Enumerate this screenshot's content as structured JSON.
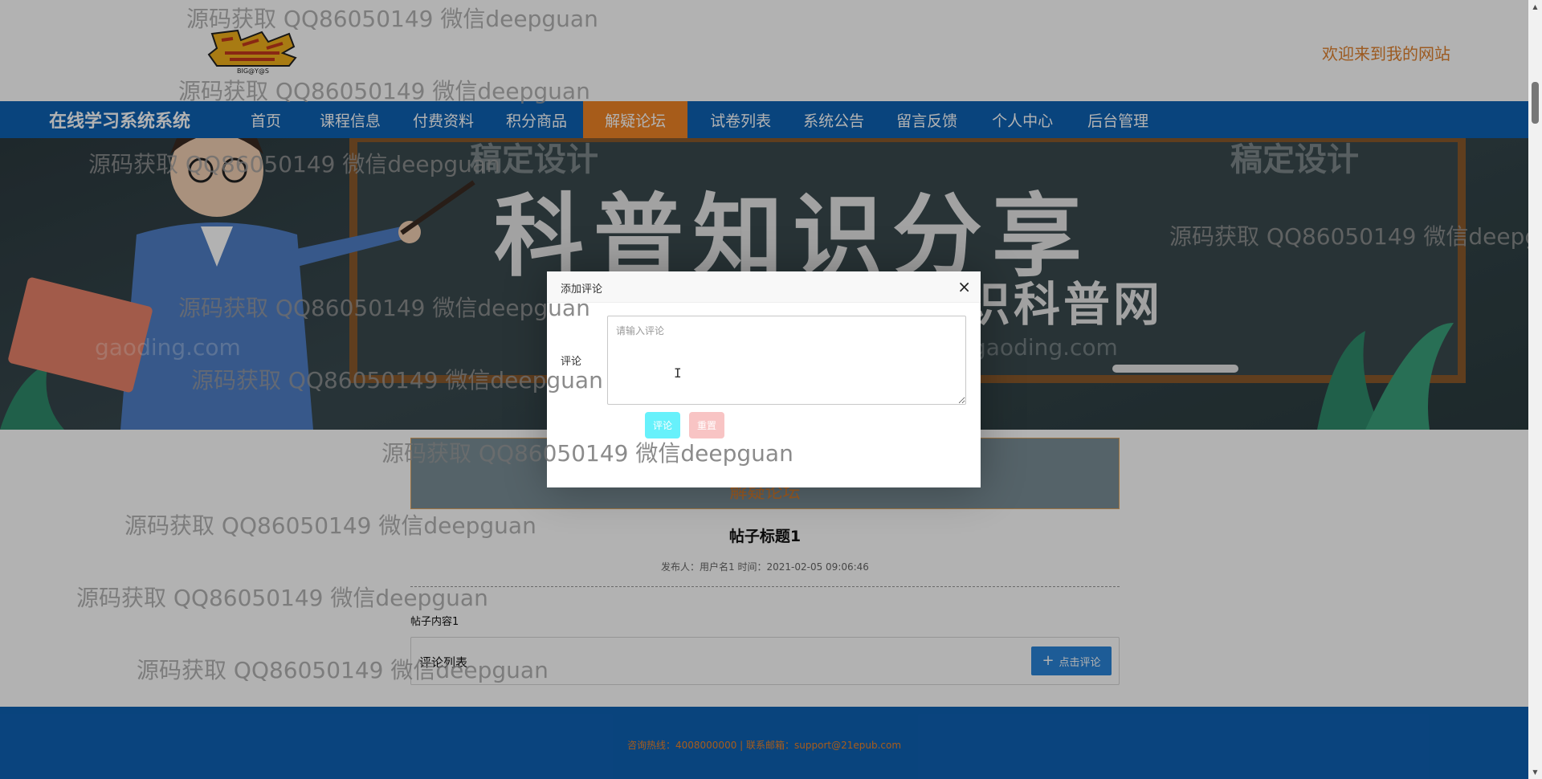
{
  "header": {
    "logo_text": "BIG@Y@S",
    "welcome": "欢迎来到我的网站"
  },
  "nav": {
    "brand": "在线学习系统系统",
    "items": [
      {
        "label": "首页"
      },
      {
        "label": "课程信息"
      },
      {
        "label": "付费资料"
      },
      {
        "label": "积分商品"
      },
      {
        "label": "解疑论坛",
        "active": true
      },
      {
        "label": "试卷列表"
      },
      {
        "label": "系统公告"
      },
      {
        "label": "留言反馈"
      },
      {
        "label": "个人中心"
      },
      {
        "label": "后台管理"
      }
    ]
  },
  "banner": {
    "title": "科普知识分享",
    "subtitle": "识科普网",
    "mark": "稿定设计",
    "domain": "gaoding.com"
  },
  "forum": {
    "section_title": "解疑论坛",
    "post_title": "帖子标题1",
    "post_meta": "发布人：用户名1 时间：2021-02-05 09:06:46",
    "post_content": "帖子内容1",
    "comment_list_label": "评论列表",
    "comment_button": "点击评论"
  },
  "footer": {
    "text": "咨询热线：4008000000 | 联系邮箱：support@21epub.com"
  },
  "modal": {
    "title": "添加评论",
    "close": "×",
    "field_label": "评论",
    "placeholder": "请输入评论",
    "submit": "评论",
    "reset": "重置"
  },
  "watermark": "源码获取 QQ86050149 微信deepguan",
  "colors": {
    "nav_bg": "#0e62b4",
    "nav_active": "#f08426",
    "welcome": "#e0822f",
    "submit_button": "#67f1fb",
    "reset_button": "#f8c4c4",
    "comment_button": "#2a84d8"
  }
}
